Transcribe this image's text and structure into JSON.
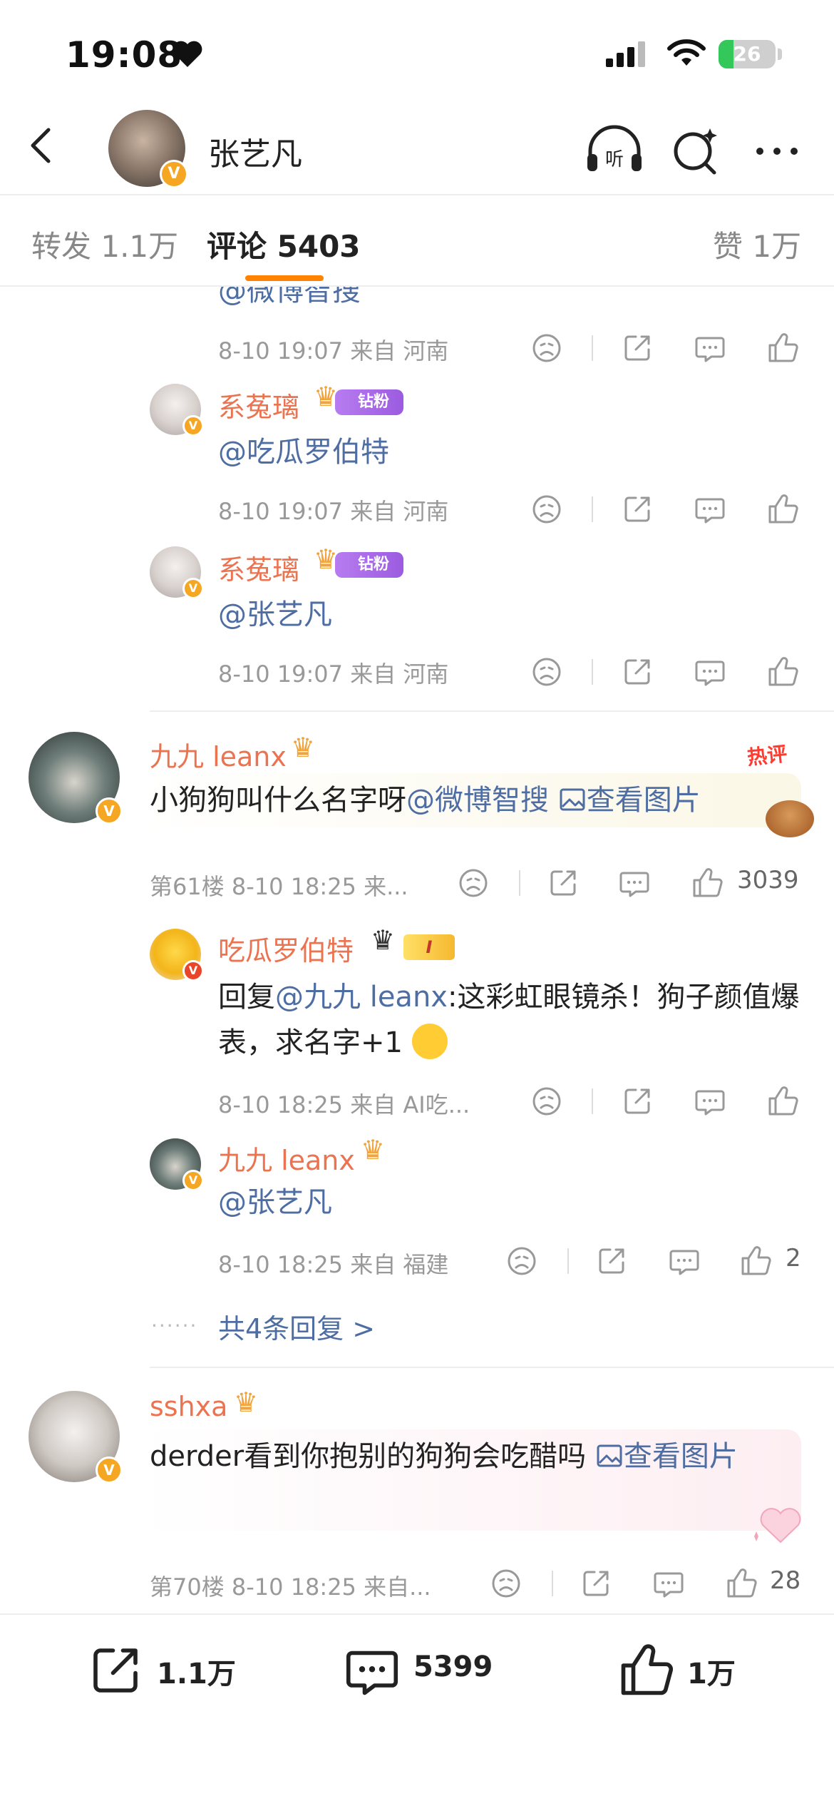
{
  "status_bar": {
    "time": "19:08",
    "battery": "26",
    "battery_level": 0.26
  },
  "header": {
    "title": "张艺凡"
  },
  "tabs": [
    {
      "label": "转发 1.1万"
    },
    {
      "label": "评论 5403"
    },
    {
      "label": "赞 1万"
    }
  ],
  "top_partial": {
    "text": "@微博智搜",
    "meta": "8-10 19:07 来自 河南"
  },
  "replies_a": [
    {
      "name": "系菟璃",
      "fan_badge": "钻粉2",
      "text": "@吃瓜罗伯特",
      "meta": "8-10 19:07 来自 河南"
    },
    {
      "name": "系菟璃",
      "fan_badge": "钻粉2",
      "text": "@张艺凡",
      "meta": "8-10 19:07 来自 河南"
    }
  ],
  "comment1": {
    "name": "九九 leanx",
    "hot_badge": "热评",
    "text_prefix": "小狗狗叫什么名字呀",
    "mention": "@微博智搜",
    "image_link": "查看图片",
    "meta": "第61楼 8-10 18:25 来...",
    "likes": "3039",
    "replies": [
      {
        "name": "吃瓜罗伯特",
        "level": "I",
        "reply_prefix": "回复",
        "reply_to": "@九九 leanx",
        "text": ":这彩虹眼镜杀！狗子颜值爆表，求名字+1",
        "meta": "8-10 18:25 来自 AI吃..."
      },
      {
        "name": "九九 leanx",
        "text": "@张艺凡",
        "meta": "8-10 18:25 来自 福建",
        "likes": "2"
      }
    ],
    "more_replies": "共4条回复 >"
  },
  "comment2": {
    "name": "sshxa",
    "text_prefix": "derder看到你抱别的狗狗会吃醋吗",
    "image_link": "查看图片",
    "meta": "第70楼 8-10 18:25 来自...",
    "likes": "28"
  },
  "bottom_bar": {
    "repost": "1.1万",
    "comment": "5399",
    "like": "1万"
  },
  "colors": {
    "accent": "#ff8200",
    "username": "#eb7350",
    "link": "#4e6ea3",
    "verified": "#f5a623"
  },
  "icons": [
    "back-icon",
    "listen-icon",
    "ai-search-icon",
    "more-icon",
    "dislike-icon",
    "share-icon",
    "comment-icon",
    "like-icon",
    "image-icon"
  ]
}
